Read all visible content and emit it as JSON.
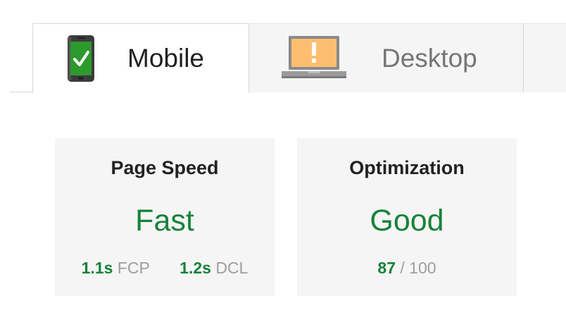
{
  "tabs": [
    {
      "label": "Mobile",
      "icon": "mobile-phone-check-icon",
      "selected": true
    },
    {
      "label": "Desktop",
      "icon": "laptop-warning-icon",
      "selected": false
    }
  ],
  "cards": {
    "page_speed": {
      "title": "Page Speed",
      "verdict": "Fast",
      "fcp_value": "1.1s",
      "fcp_label": "FCP",
      "dcl_value": "1.2s",
      "dcl_label": "DCL"
    },
    "optimization": {
      "title": "Optimization",
      "verdict": "Good",
      "score": "87",
      "score_suffix": "/ 100"
    }
  },
  "colors": {
    "good_green": "#178239",
    "phone_green": "#2d9a2d",
    "warning_orange": "#fdbf6f",
    "card_bg": "#f5f5f5"
  }
}
